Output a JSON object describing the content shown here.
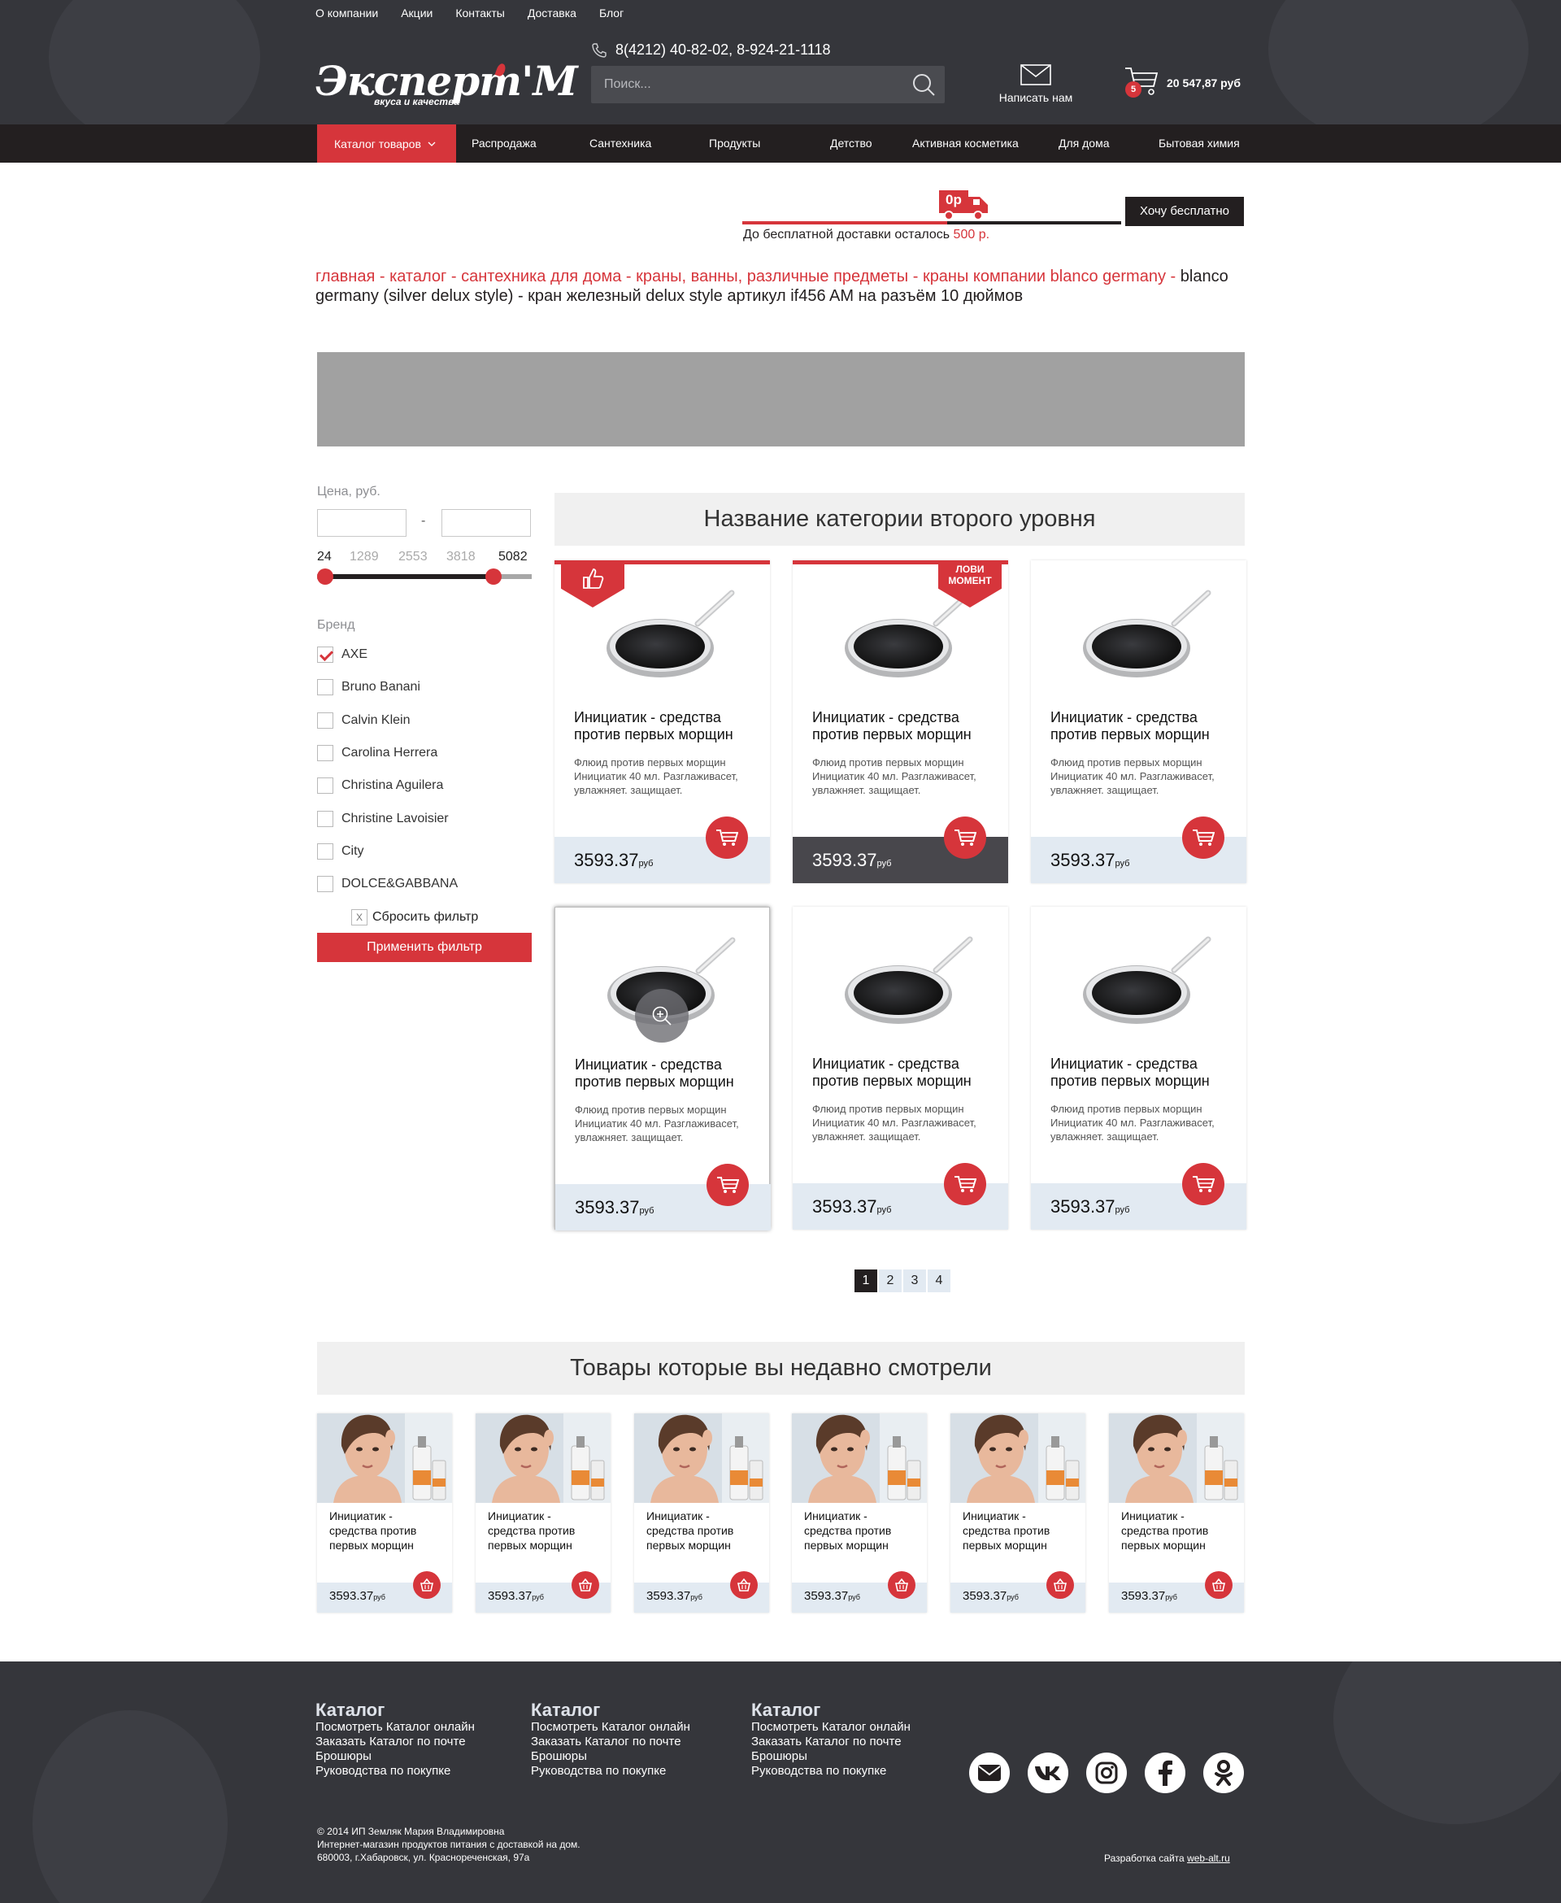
{
  "topnav": [
    "О компании",
    "Акции",
    "Контакты",
    "Доставка",
    "Блог"
  ],
  "logo": {
    "text": "Эксперт'M",
    "subtitle": "вкуса и качества"
  },
  "phone": "8(4212) 40-82-02, 8-924-21-1118",
  "search": {
    "placeholder": "Поиск..."
  },
  "write_us": "Написать нам",
  "cart": {
    "count": "5",
    "total": "20 547,87 руб"
  },
  "mainnav": {
    "catalog": "Каталог товаров",
    "items": [
      "Распродажа",
      "Сантехника",
      "Продукты",
      "Детство",
      "Активная косметика",
      "Для дома",
      "Бытовая химия"
    ]
  },
  "delivery": {
    "truck_label": "0р",
    "text": "До бесплатной доставки осталось",
    "amount": "500 р.",
    "button": "Хочу бесплатно",
    "progress": 0.54
  },
  "breadcrumb": {
    "links": [
      "главная",
      "каталог",
      "сантехника для дома",
      "краны, ванны, различные предметы",
      "краны компании blanco germany"
    ],
    "separator": " - ",
    "current": "blanco germany (silver delux style) - кран железный delux style артикул if456 AM на разъём 10 дюймов"
  },
  "filter": {
    "price_label": "Цена, руб.",
    "price_from": "",
    "price_to": "",
    "dash": "-",
    "ticks": [
      "24",
      "1289",
      "2553",
      "3818",
      "5082"
    ],
    "range_min_fraction": 0.0,
    "range_max_fraction": 0.85,
    "brand_label": "Бренд",
    "brands": [
      {
        "name": "AXE",
        "checked": true
      },
      {
        "name": "Bruno Banani",
        "checked": false
      },
      {
        "name": "Calvin Klein",
        "checked": false
      },
      {
        "name": "Carolina Herrera",
        "checked": false
      },
      {
        "name": "Christina Aguilera",
        "checked": false
      },
      {
        "name": "Christine Lavoisier",
        "checked": false
      },
      {
        "name": "City",
        "checked": false
      },
      {
        "name": "DOLCE&GABBANA",
        "checked": false
      }
    ],
    "reset_x": "X",
    "reset": "Сбросить фильтр",
    "apply": "Применить фильтр"
  },
  "category": {
    "title": "Название категории второго уровня",
    "products": [
      {
        "name": "Инициатик - средства против первых морщин",
        "desc": "Флюид против первых морщин Инициатик 40 мл. Разглаживасет, увлажняет. защищает.",
        "price": "3593.37",
        "currency": "руб",
        "badge": "like"
      },
      {
        "name": "Инициатик - средства против первых морщин",
        "desc": "Флюид против первых морщин Инициатик 40 мл. Разглаживасет, увлажняет. защищает.",
        "price": "3593.37",
        "currency": "руб",
        "badge": "ЛОВИ МОМЕНТ"
      },
      {
        "name": "Инициатик - средства против первых морщин",
        "desc": "Флюид против первых морщин Инициатик 40 мл. Разглаживасет, увлажняет. защищает.",
        "price": "3593.37",
        "currency": "руб",
        "badge": ""
      },
      {
        "name": "Инициатик - средства против первых морщин",
        "desc": "Флюид против первых морщин Инициатик 40 мл. Разглаживасет, увлажняет. защищает.",
        "price": "3593.37",
        "currency": "руб",
        "badge": ""
      },
      {
        "name": "Инициатик - средства против первых морщин",
        "desc": "Флюид против первых морщин Инициатик 40 мл. Разглаживасет, увлажняет. защищает.",
        "price": "3593.37",
        "currency": "руб",
        "badge": ""
      },
      {
        "name": "Инициатик - средства против первых морщин",
        "desc": "Флюид против первых морщин Инициатик 40 мл. Разглаживасет, увлажняет. защищает.",
        "price": "3593.37",
        "currency": "руб",
        "badge": ""
      }
    ],
    "badge_like_icon": "thumbs-up-icon",
    "badge_moment_line1": "ЛОВИ",
    "badge_moment_line2": "МОМЕНТ"
  },
  "pager": [
    "1",
    "2",
    "3",
    "4"
  ],
  "recent": {
    "title": "Товары которые вы недавно смотрели",
    "items": [
      {
        "name": "Инициатик - средства против первых морщин",
        "price": "3593.37",
        "currency": "руб"
      },
      {
        "name": "Инициатик - средства против первых морщин",
        "price": "3593.37",
        "currency": "руб"
      },
      {
        "name": "Инициатик - средства против первых морщин",
        "price": "3593.37",
        "currency": "руб"
      },
      {
        "name": "Инициатик - средства против первых морщин",
        "price": "3593.37",
        "currency": "руб"
      },
      {
        "name": "Инициатик - средства против первых морщин",
        "price": "3593.37",
        "currency": "руб"
      },
      {
        "name": "Инициатик - средства против первых морщин",
        "price": "3593.37",
        "currency": "руб"
      }
    ]
  },
  "footer": {
    "columns": [
      {
        "title": "Каталог",
        "links": [
          "Посмотреть Каталог онлайн",
          "Заказать Каталог по почте",
          "Брошюры",
          "Руководства по покупке"
        ]
      },
      {
        "title": "Каталог",
        "links": [
          "Посмотреть Каталог онлайн",
          "Заказать Каталог по почте",
          "Брошюры",
          "Руководства по покупке"
        ]
      },
      {
        "title": "Каталог",
        "links": [
          "Посмотреть Каталог онлайн",
          "Заказать Каталог по почте",
          "Брошюры",
          "Руководства по покупке"
        ]
      }
    ],
    "social": [
      "mail-icon",
      "vk-icon",
      "instagram-icon",
      "facebook-icon",
      "odnoklassniki-icon"
    ],
    "copyright": [
      "© 2014 ИП Земляк Мария Владимировна",
      "Интернет-магазин продуктов питания с доставкой на дом.",
      "680003, г.Хабаровск, ул. Краснореченская, 97а"
    ],
    "dev_label": "Разработка сайта",
    "dev_link": "web-alt.ru"
  },
  "colors": {
    "accent": "#d6353b",
    "dark": "#231f20",
    "header_bg": "#35363b",
    "price_bg": "#e2eaf2"
  }
}
